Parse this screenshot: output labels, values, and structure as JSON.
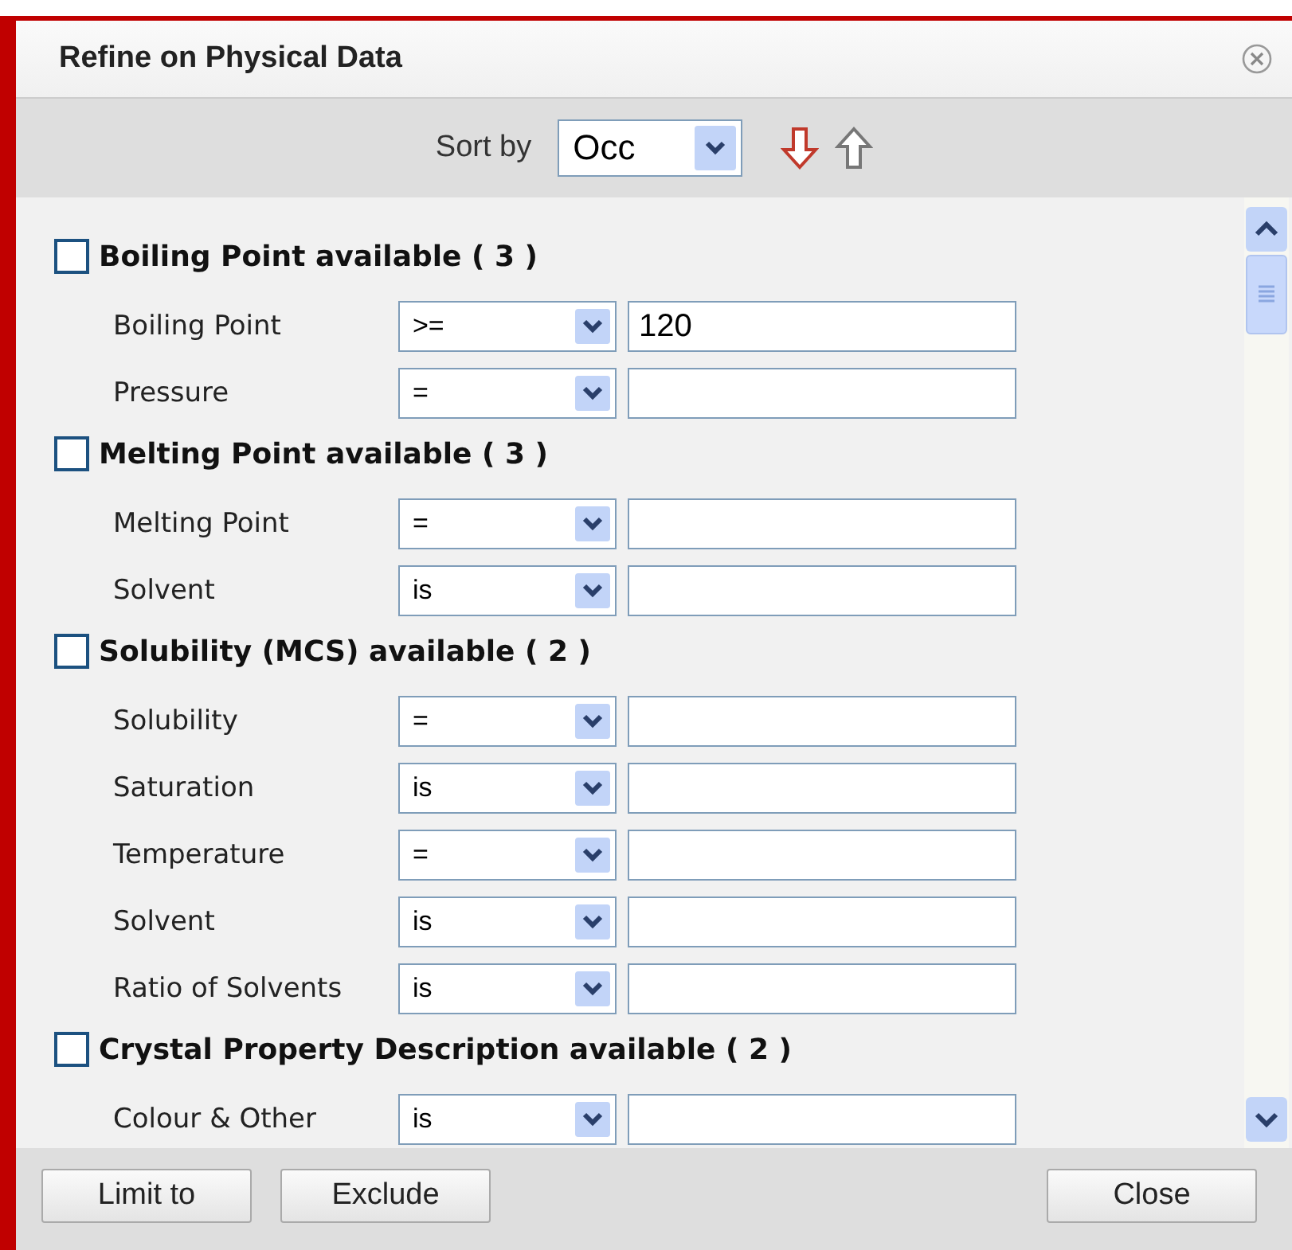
{
  "window": {
    "title": "Refine on Physical Data"
  },
  "sort": {
    "label": "Sort by",
    "value": "Occ",
    "descending": true
  },
  "groups": [
    {
      "title": "Boiling Point available ( 3 )",
      "checked": false,
      "fields": [
        {
          "label": "Boiling Point",
          "operator": ">=",
          "value": "120"
        },
        {
          "label": "Pressure",
          "operator": "="
        }
      ]
    },
    {
      "title": "Melting Point available ( 3 )",
      "checked": false,
      "fields": [
        {
          "label": "Melting Point",
          "operator": "="
        },
        {
          "label": "Solvent",
          "operator": "is"
        }
      ]
    },
    {
      "title": "Solubility (MCS) available ( 2 )",
      "checked": false,
      "fields": [
        {
          "label": "Solubility",
          "operator": "="
        },
        {
          "label": "Saturation",
          "operator": "is"
        },
        {
          "label": "Temperature",
          "operator": "="
        },
        {
          "label": "Solvent",
          "operator": "is"
        },
        {
          "label": "Ratio of Solvents",
          "operator": "is"
        }
      ]
    },
    {
      "title": "Crystal Property Description available ( 2 )",
      "checked": false,
      "fields": [
        {
          "label": "Colour & Other",
          "operator": "is"
        }
      ]
    }
  ],
  "buttons": [
    {
      "label": "Limit to"
    },
    {
      "label": "Exclude"
    },
    {
      "label": "Close"
    }
  ]
}
